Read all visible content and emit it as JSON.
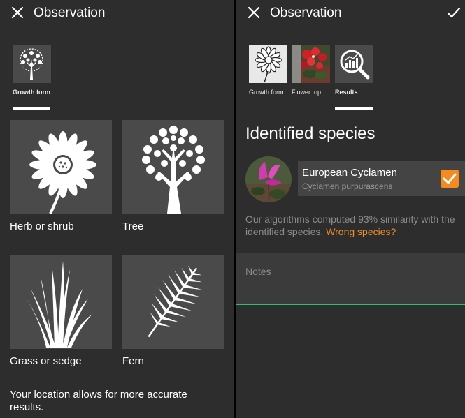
{
  "left_panel": {
    "title": "Observation",
    "tabs": [
      {
        "label": "Growth form"
      }
    ],
    "tiles": [
      {
        "label": "Herb or shrub"
      },
      {
        "label": "Tree"
      },
      {
        "label": "Grass or sedge"
      },
      {
        "label": "Fern"
      }
    ],
    "location_text": "Your location allows for more accurate results."
  },
  "right_panel": {
    "title": "Observation",
    "tabs": [
      {
        "label": "Growth form"
      },
      {
        "label": "Flower top"
      },
      {
        "label": "Results"
      }
    ],
    "section_title": "Identified species",
    "species": {
      "name": "European Cyclamen",
      "scientific_name": "Cyclamen purpurascens",
      "selected": true
    },
    "similarity_text": "Our algorithms computed 93% similarity with the identified species.",
    "wrong_species_link": "Wrong species?",
    "notes_placeholder": "Notes"
  },
  "colors": {
    "background": "#2d2d2d",
    "tile": "#4a4a4a",
    "accent_orange": "#f58a1f",
    "notes_underline": "#2fbf71",
    "secondary_text": "#8c8c8c"
  },
  "icons": [
    "close-icon",
    "checkmark-icon",
    "magnifier-chart-icon",
    "flower-icon",
    "tree-icon",
    "grass-icon",
    "fern-icon"
  ]
}
